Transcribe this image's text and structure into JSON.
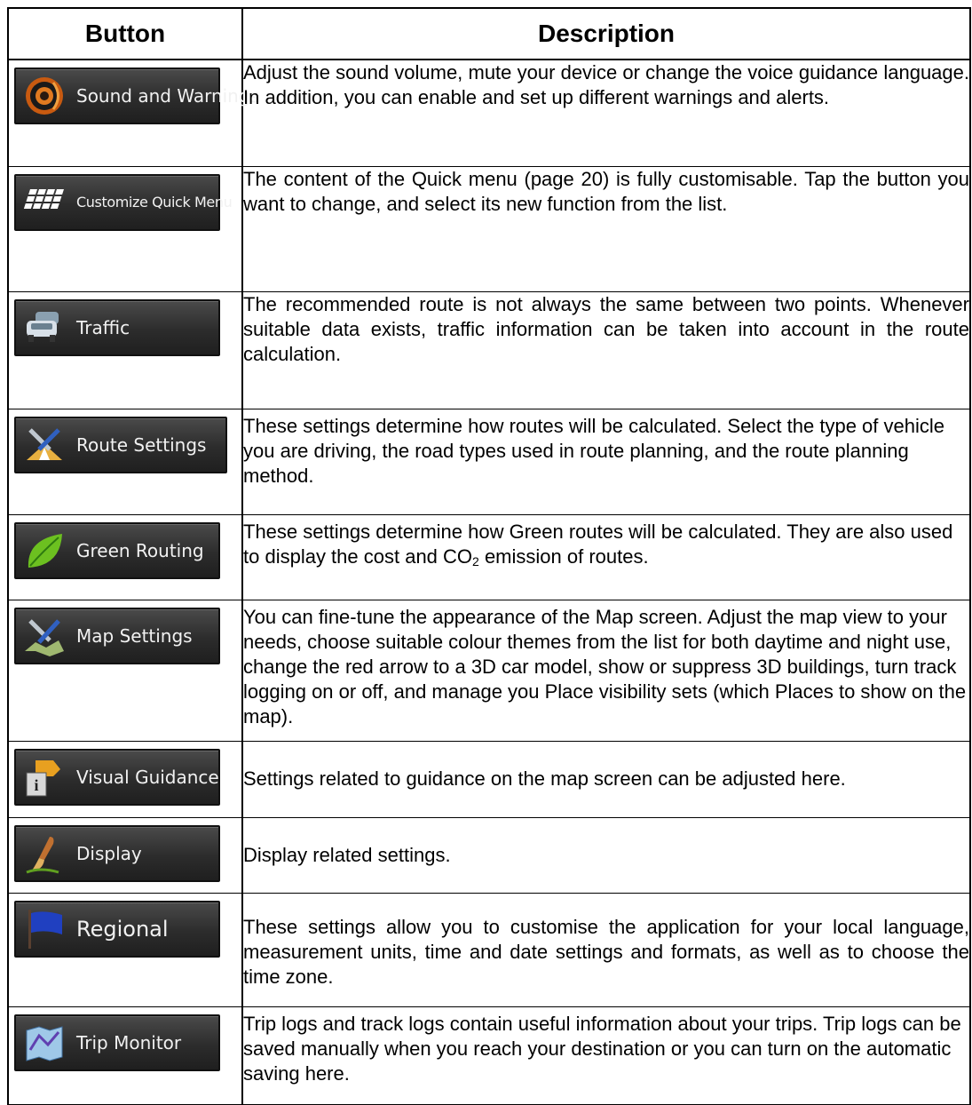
{
  "table": {
    "header_button": "Button",
    "header_description": "Description"
  },
  "rows": [
    {
      "button_label": "Sound and Warnings",
      "icon": "speaker-icon",
      "description": "Adjust the sound volume, mute your device or change the voice guidance language. In addition, you can enable and set up different warnings and alerts."
    },
    {
      "button_label": "Customize Quick Menu",
      "icon": "quick-menu-grid-icon",
      "description": "The content of the Quick menu (page 20) is fully customisable. Tap the button you want to change, and select its new function from the list."
    },
    {
      "button_label": "Traffic",
      "icon": "traffic-cars-icon",
      "description": "The recommended route is not always the same between two points. Whenever suitable data exists, traffic information can be taken into account in the route calculation."
    },
    {
      "button_label": "Route Settings",
      "icon": "route-tools-icon",
      "description": "These settings determine how routes will be calculated. Select the type of vehicle you are driving, the road types used in route planning, and the route planning method."
    },
    {
      "button_label": "Green Routing",
      "icon": "leaf-icon",
      "description_before": "These settings determine how Green routes will be calculated. They are also used to display the cost and CO",
      "description_sub": "2",
      "description_after": " emission of routes."
    },
    {
      "button_label": "Map Settings",
      "icon": "map-tools-icon",
      "description": "You can fine-tune the appearance of the Map screen. Adjust the map view to your needs, choose suitable colour themes from the list for both daytime and night use, change the red arrow to a 3D car model, show or suppress 3D buildings, turn track logging on or off, and manage you Place visibility sets (which Places to show on the map)."
    },
    {
      "button_label": "Visual Guidance",
      "icon": "info-signpost-icon",
      "description": "Settings related to guidance on the map screen can be adjusted here."
    },
    {
      "button_label": "Display",
      "icon": "paintbrush-icon",
      "description": "Display related settings."
    },
    {
      "button_label": "Regional",
      "icon": "flag-icon",
      "description": "These settings allow you to customise the application for your local language, measurement units, time and date settings and formats, as well as to choose the time zone."
    },
    {
      "button_label": "Trip Monitor",
      "icon": "trip-map-icon",
      "description": "Trip logs and track logs contain useful information about your trips. Trip logs can be saved manually when you reach your destination or you can turn on the automatic saving here."
    }
  ]
}
